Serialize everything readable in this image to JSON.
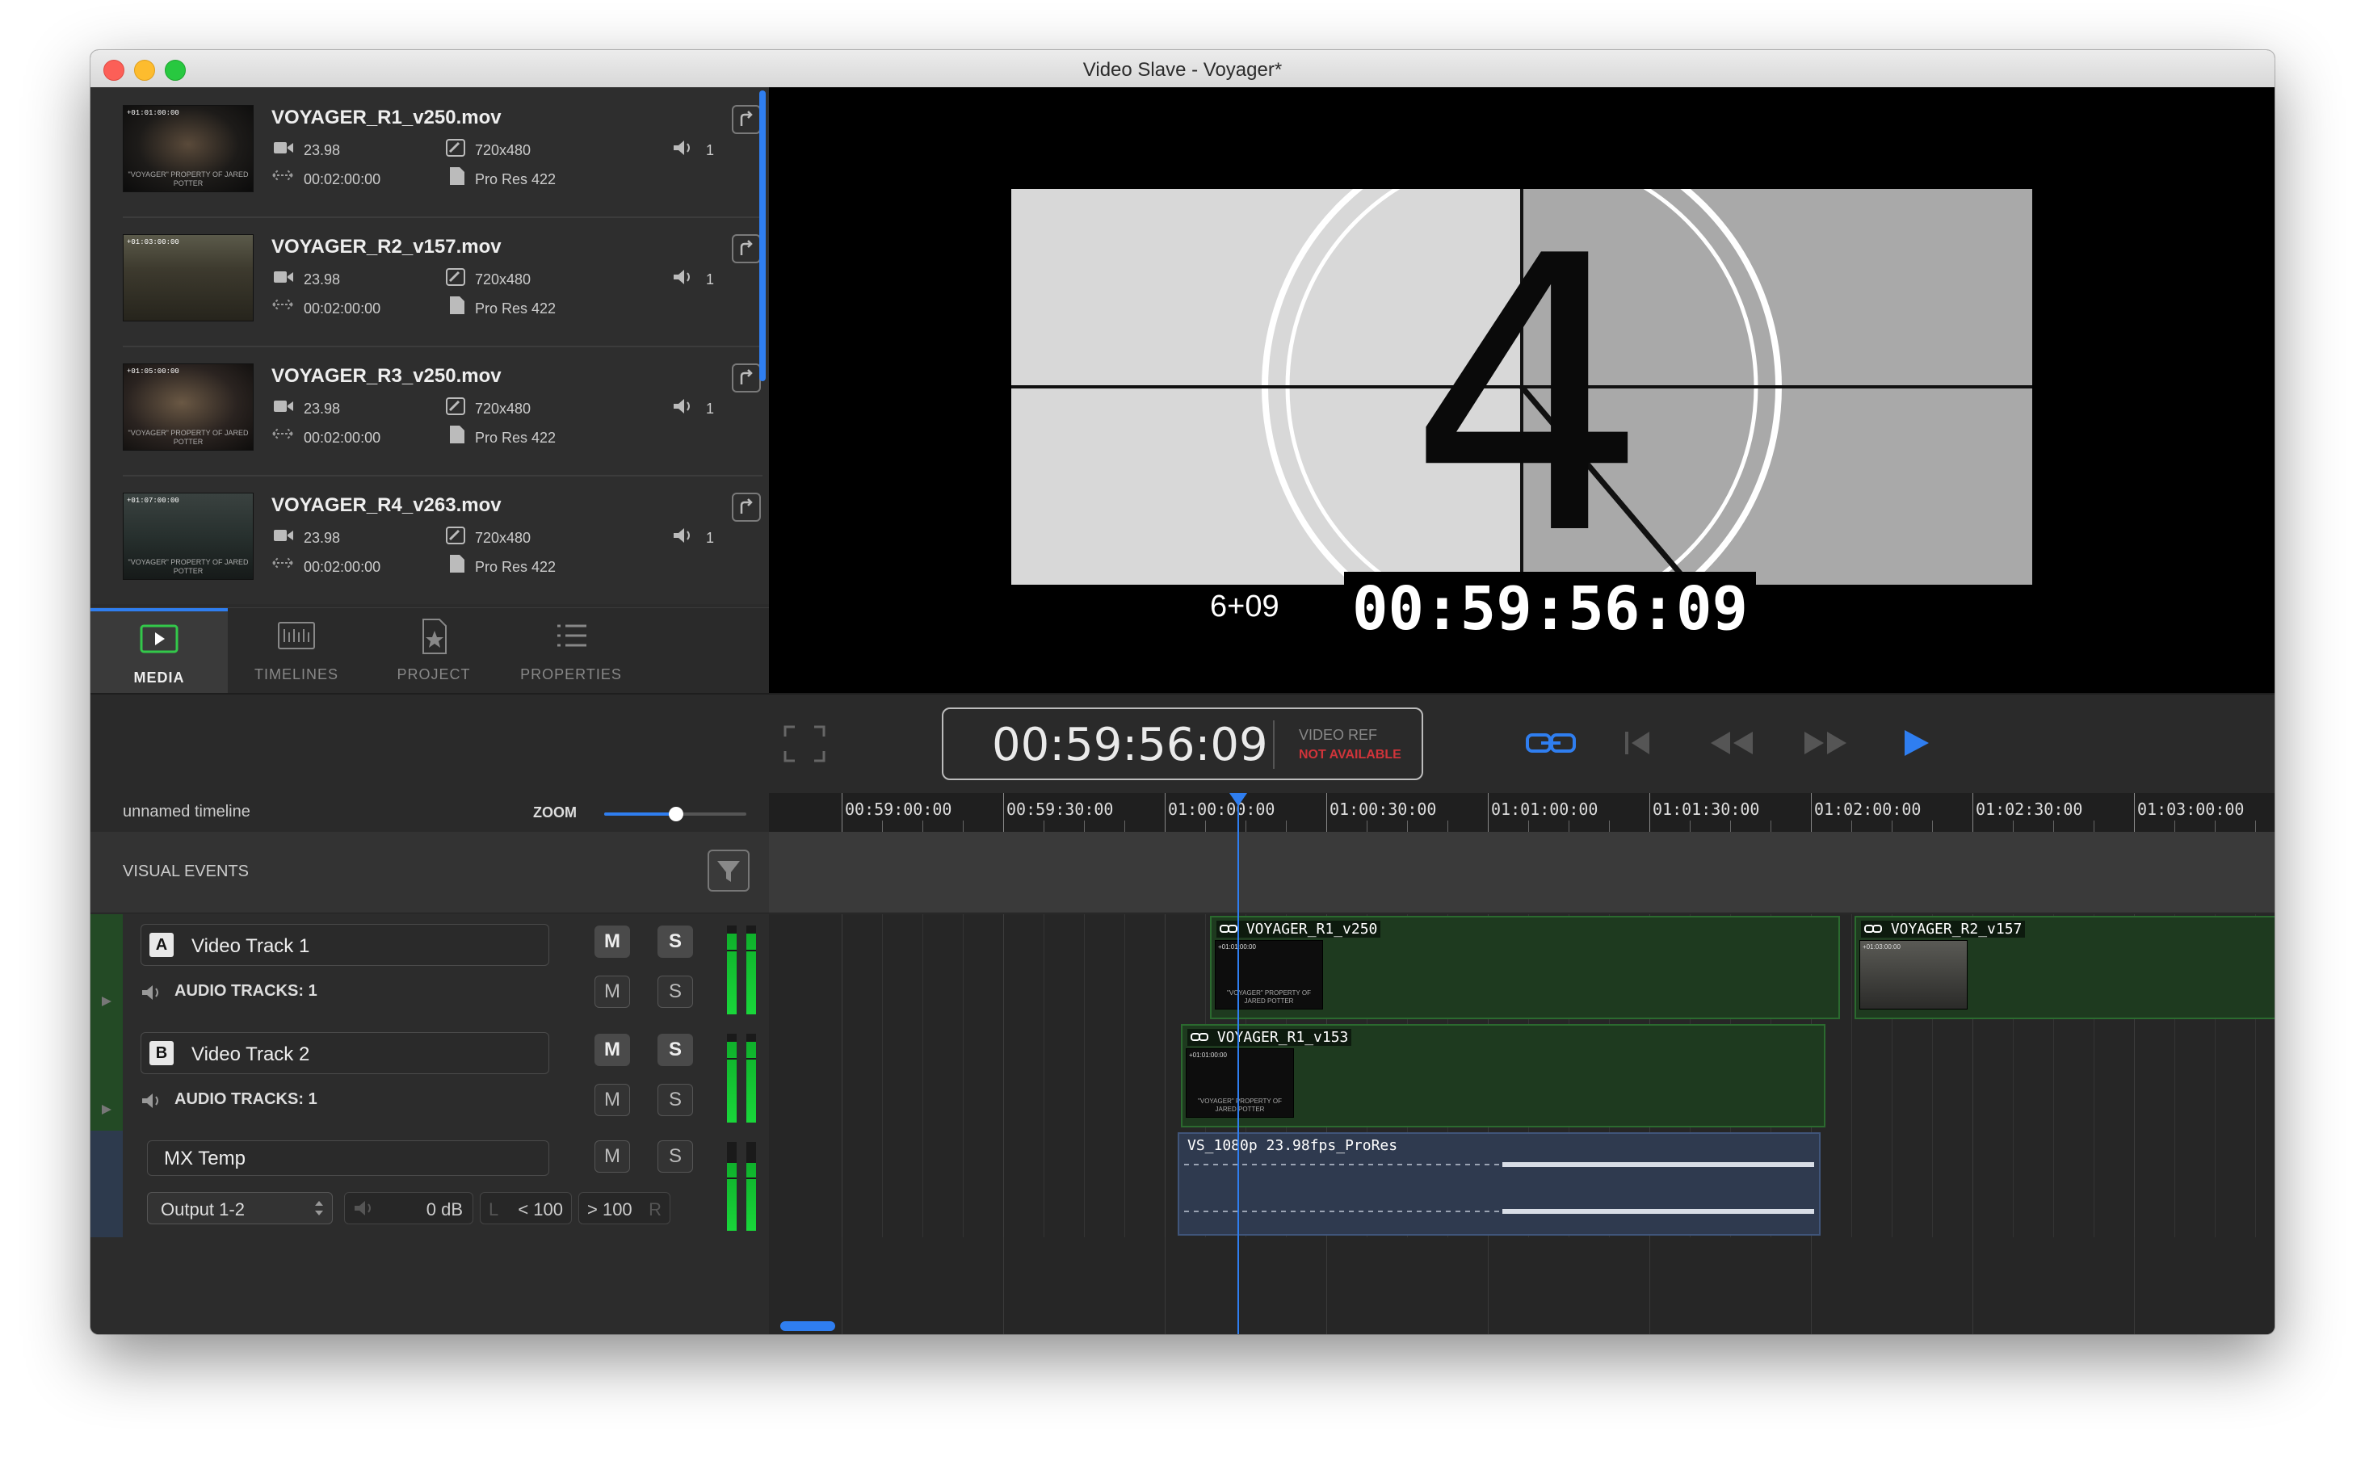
{
  "window": {
    "title": "Video Slave - Voyager*"
  },
  "media": {
    "items": [
      {
        "name": "VOYAGER_R1_v250.mov",
        "fps": "23.98",
        "resolution": "720x480",
        "channels": "1",
        "duration": "00:02:00:00",
        "codec": "Pro Res 422",
        "thumb_tc": "+01:01:00:00",
        "thumb_cap": "\"VOYAGER\" PROPERTY OF JARED POTTER"
      },
      {
        "name": "VOYAGER_R2_v157.mov",
        "fps": "23.98",
        "resolution": "720x480",
        "channels": "1",
        "duration": "00:02:00:00",
        "codec": "Pro Res 422",
        "thumb_tc": "+01:03:00:00",
        "thumb_cap": ""
      },
      {
        "name": "VOYAGER_R3_v250.mov",
        "fps": "23.98",
        "resolution": "720x480",
        "channels": "1",
        "duration": "00:02:00:00",
        "codec": "Pro Res 422",
        "thumb_tc": "+01:05:00:00",
        "thumb_cap": "\"VOYAGER\" PROPERTY OF JARED POTTER"
      },
      {
        "name": "VOYAGER_R4_v263.mov",
        "fps": "23.98",
        "resolution": "720x480",
        "channels": "1",
        "duration": "00:02:00:00",
        "codec": "Pro Res 422",
        "thumb_tc": "+01:07:00:00",
        "thumb_cap": "\"VOYAGER\" PROPERTY OF JARED POTTER"
      }
    ]
  },
  "tabs": [
    {
      "label": "MEDIA",
      "active": true
    },
    {
      "label": "TIMELINES"
    },
    {
      "label": "PROJECT"
    },
    {
      "label": "PROPERTIES"
    }
  ],
  "viewer": {
    "leader_number": "4",
    "frame_burn": "6+09",
    "tc_burn": "00:59:56:09"
  },
  "transport": {
    "timecode": "00:59:56:09",
    "video_ref_label": "VIDEO REF",
    "video_ref_status": "NOT AVAILABLE"
  },
  "timeline": {
    "name": "unnamed timeline",
    "zoom_label": "ZOOM",
    "zoom_level": 0.5,
    "ruler": [
      "00:59:00:00",
      "00:59:30:00",
      "01:00:00:00",
      "01:00:30:00",
      "01:01:00:00",
      "01:01:30:00",
      "01:02:00:00",
      "01:02:30:00",
      "01:03:00:00"
    ],
    "visual_events_label": "VISUAL EVENTS"
  },
  "tracks": [
    {
      "letter": "A",
      "name": "Video Track 1",
      "audio_label": "AUDIO TRACKS:",
      "audio_count": "1",
      "mute": "M",
      "solo": "S"
    },
    {
      "letter": "B",
      "name": "Video Track 2",
      "audio_label": "AUDIO TRACKS:",
      "audio_count": "1",
      "mute": "M",
      "solo": "S"
    }
  ],
  "mx_track": {
    "name": "MX Temp",
    "output": "Output 1-2",
    "gain": "0 dB",
    "pan_l_prefix": "L",
    "pan_l": "< 100",
    "pan_r": "> 100",
    "pan_r_suffix": "R",
    "mute": "M",
    "solo": "S"
  },
  "clips": {
    "track1_a": "VOYAGER_R1_v250",
    "track1_b": "VOYAGER_R2_v157",
    "track2_a": "VOYAGER_R1_v153",
    "mx_a": "VS_1080p 23.98fps_ProRes",
    "thumb_tc_a": "+01:01:00:00",
    "thumb_tc_b": "+01:03:00:00",
    "thumb_cap": "\"VOYAGER\" PROPERTY OF JARED POTTER"
  },
  "colors": {
    "accent": "#2f7ef0",
    "video_clip": "#1e3a1f",
    "audio_clip": "#2f3a4f",
    "alert": "#d0343a",
    "meter": "#19d63a"
  }
}
